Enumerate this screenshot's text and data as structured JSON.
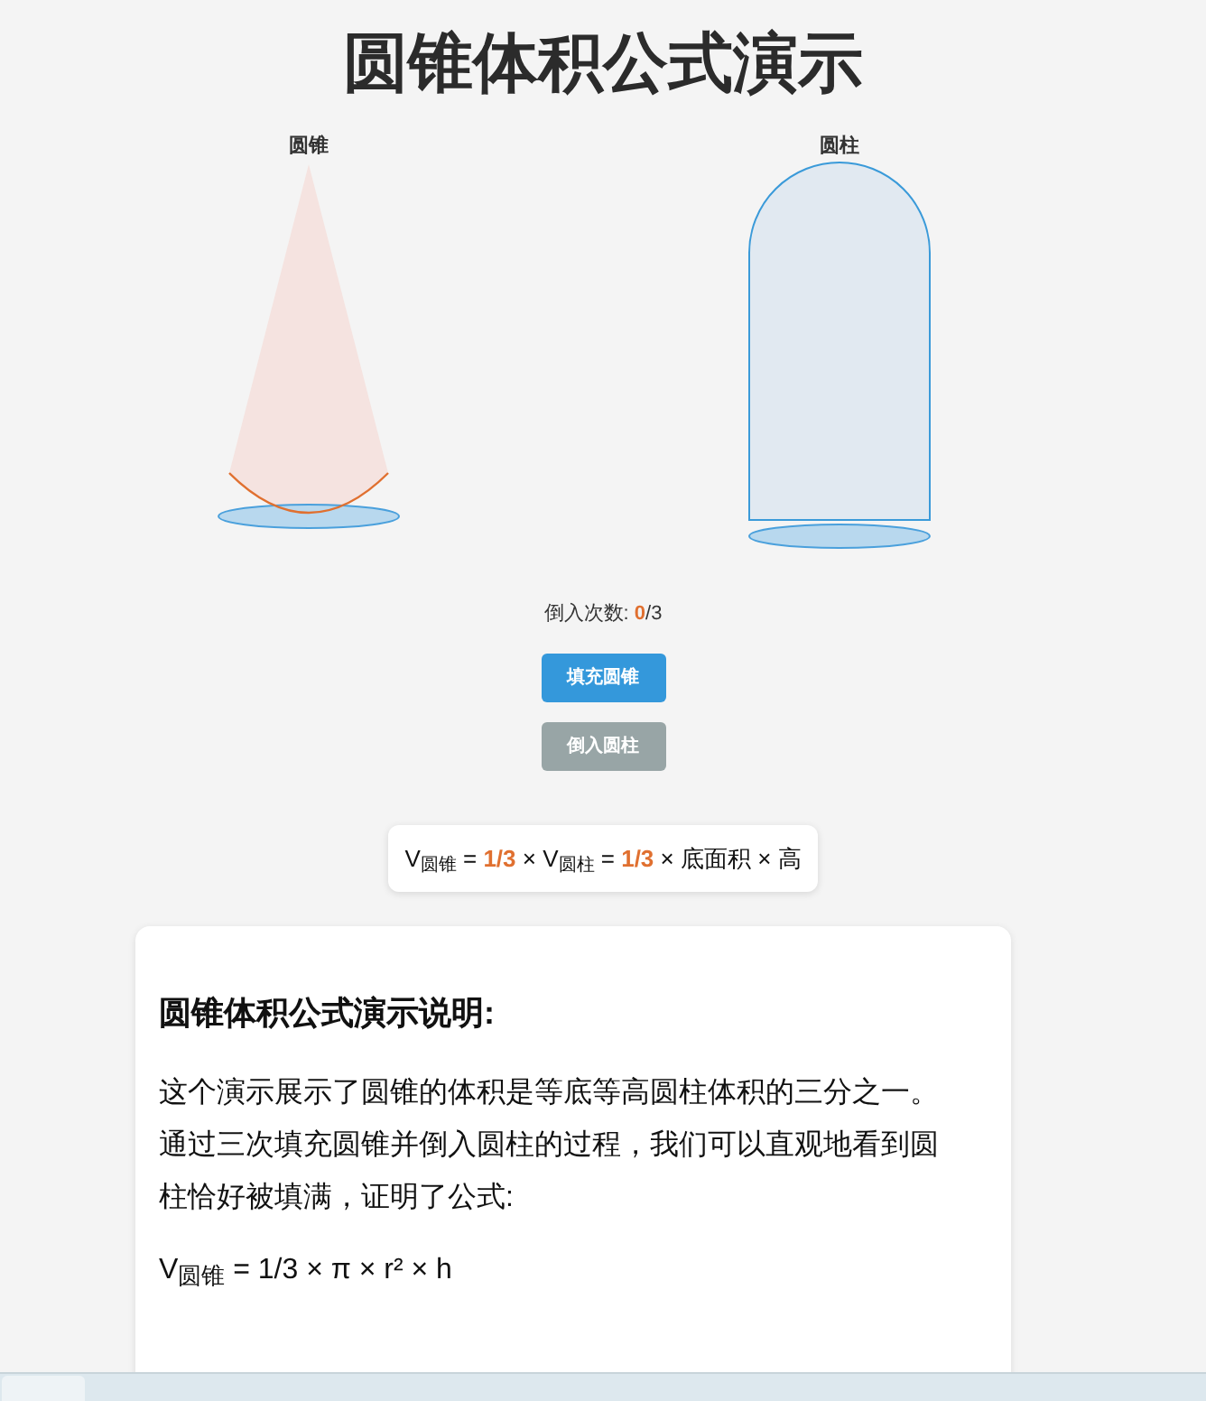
{
  "title": "圆锥体积公式演示",
  "shapes": [
    {
      "kind": "cone",
      "label": "圆锥"
    },
    {
      "kind": "cylinder",
      "label": "圆柱"
    }
  ],
  "pour_count": {
    "label": "倒入次数: ",
    "count": "0",
    "total": "/3"
  },
  "buttons": [
    {
      "label": "填充圆锥",
      "disabled": false
    },
    {
      "label": "倒入圆柱",
      "disabled": true
    }
  ],
  "formula": "V$_{圆锥}$ = **1/3** × V$_{圆柱}$ = **1/3** × 底面积 × 高",
  "explanation": {
    "heading": "圆锥体积公式演示说明:",
    "paragraph": "这个演示展示了圆锥的体积是等底等高圆柱体积的三分之一。通过三次填充圆锥并倒入圆柱的过程，我们可以直观地看到圆柱恰好被填满，证明了公式:",
    "formula": "V$_{圆锥}$ = 1/3 × π × r² × h"
  }
}
